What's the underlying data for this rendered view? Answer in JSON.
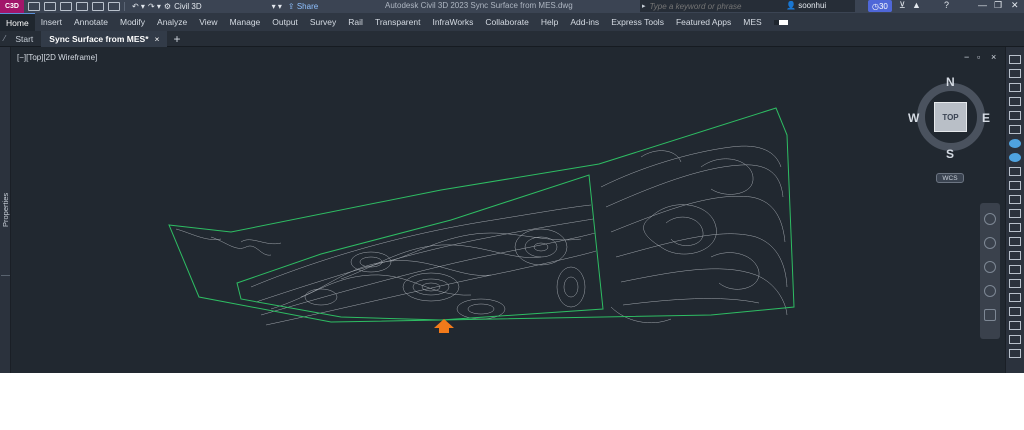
{
  "app": {
    "logo": "C3D",
    "workspace": "Civil 3D",
    "share_label": "Share",
    "title": "Autodesk Civil 3D 2023    Sync Surface from MES.dwg",
    "search_placeholder": "Type a keyword or phrase",
    "user": "soonhui",
    "timer": "30",
    "colors": {
      "accent": "#5b8fd9",
      "surface_boundary": "#2ebd63",
      "marker": "#f27a1a",
      "logo": "#a2156a"
    }
  },
  "ribbon": {
    "tabs": [
      "Home",
      "Insert",
      "Annotate",
      "Modify",
      "Analyze",
      "View",
      "Manage",
      "Output",
      "Survey",
      "Rail",
      "Transparent",
      "InfraWorks",
      "Collaborate",
      "Help",
      "Add-ins",
      "Express Tools",
      "Featured Apps",
      "MES"
    ],
    "active_tab": "Home"
  },
  "doc_tabs": {
    "start": "Start",
    "active": "Sync Surface from MES*",
    "close": "×",
    "add": "+"
  },
  "palettes": {
    "properties": "Properties"
  },
  "viewport": {
    "label": "[−][Top][2D Wireframe]",
    "controls": [
      "−",
      "▫",
      "×"
    ]
  },
  "viewcube": {
    "n": "N",
    "s": "S",
    "e": "E",
    "w": "W",
    "top": "TOP",
    "wcs": "WCS"
  },
  "icons": {
    "marker": "arrow-up-icon",
    "navigation": [
      "steering-wheel-icon",
      "pan-icon",
      "zoom-icon",
      "orbit-icon",
      "showmotion-icon"
    ]
  }
}
